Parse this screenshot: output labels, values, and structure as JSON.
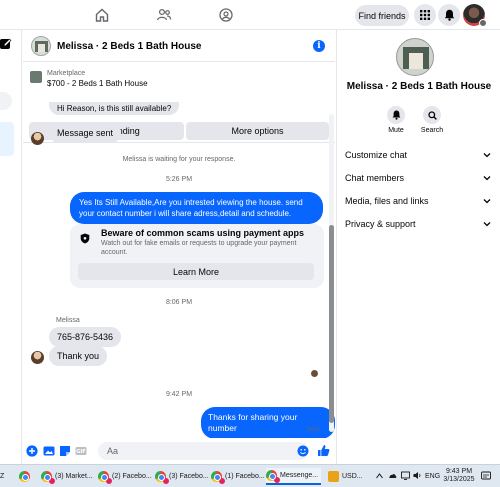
{
  "topbar": {
    "find_friends_label": "Find friends",
    "nav_icons": [
      "home-icon",
      "friends-icon",
      "groups-icon"
    ],
    "right_icons": [
      "menu-grid-icon",
      "notifications-bell-icon",
      "profile-avatar"
    ]
  },
  "chat": {
    "title": "Melissa · 2 Beds 1 Bath House",
    "marketplace_label": "Marketplace",
    "listing": "$700 - 2 Beds 1 Bath House",
    "mark_pending_label": "Mark as pending",
    "more_options_label": "More options",
    "partial_top_message": "Hi Reason, is this still available?",
    "messages": [
      {
        "from": "them",
        "text": "Message sent"
      },
      {
        "type": "note",
        "text": "Melissa is waiting for your response."
      },
      {
        "type": "time",
        "text": "5:26 PM"
      },
      {
        "from": "me",
        "text": "Yes Its Still Available,Are you intrested viewing the house. send your contact number i will share adress,detail and schedule."
      },
      {
        "type": "time",
        "text": "8:06 PM"
      },
      {
        "type": "sender",
        "text": "Melissa"
      },
      {
        "from": "them",
        "text": "765-876-5436"
      },
      {
        "from": "them",
        "text": "Thank you"
      },
      {
        "type": "time",
        "text": "9:42 PM"
      },
      {
        "from": "me",
        "text": "Thanks for sharing your number"
      }
    ],
    "scam_card": {
      "title": "Beware of common scams using payment apps",
      "subtitle": "Watch out for fake emails or requests to upgrade your payment account.",
      "button_label": "Learn More"
    },
    "sent_status": "Sent",
    "composer_placeholder": "Aa"
  },
  "right_panel": {
    "name": "Melissa · 2 Beds 1 Bath House",
    "actions": [
      {
        "label": "Mute",
        "icon": "bell-icon"
      },
      {
        "label": "Search",
        "icon": "search-icon"
      }
    ],
    "sections": [
      "Customize chat",
      "Chat members",
      "Media, files and links",
      "Privacy & support"
    ]
  },
  "taskbar": {
    "items": [
      "(3) Market...",
      "(2) Facebo...",
      "(3) Facebo...",
      "(1) Facebo...",
      "Messenge..."
    ],
    "tray": {
      "currency": "USD...",
      "language": "ENG",
      "time": "9:43 PM",
      "date": "3/13/2025"
    }
  },
  "colors": {
    "accent": "#0866ff",
    "bubble_in": "#e4e6eb",
    "secondary_text": "#65676b"
  }
}
